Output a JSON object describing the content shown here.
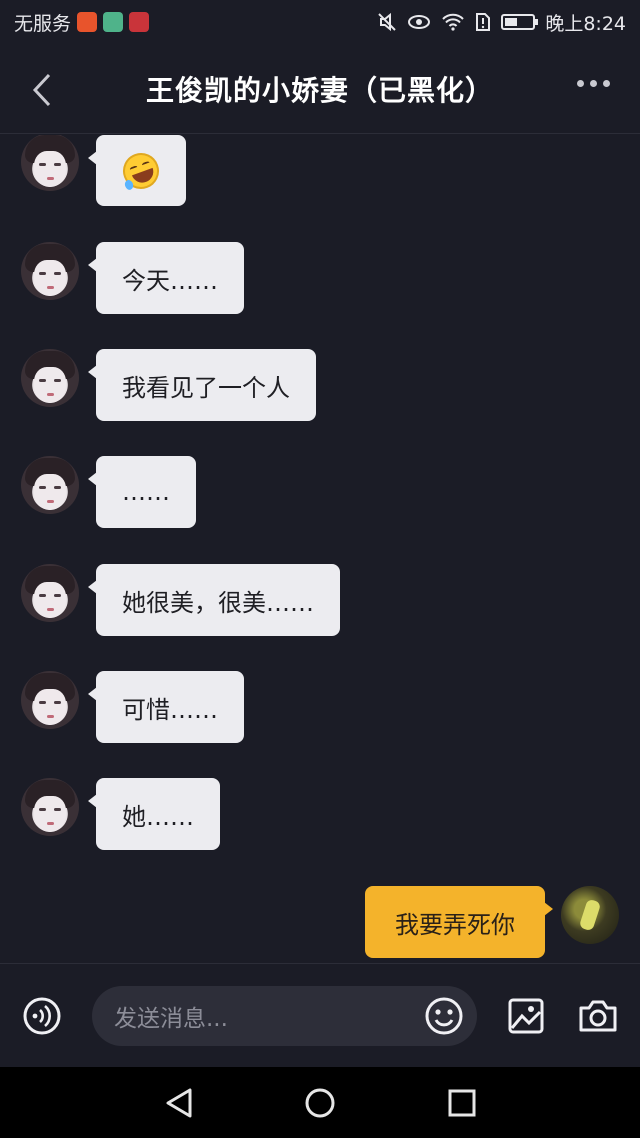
{
  "status_bar": {
    "carrier": "无服务",
    "time": "晚上8:24",
    "battery_level": 0.45
  },
  "header": {
    "title": "王俊凯的小娇妻（已黑化）"
  },
  "messages": [
    {
      "side": "left",
      "type": "emoji",
      "emoji": "rolling-on-floor-laughing-emoji",
      "text": ""
    },
    {
      "side": "left",
      "type": "text",
      "text": "今天……"
    },
    {
      "side": "left",
      "type": "text",
      "text": "我看见了一个人"
    },
    {
      "side": "left",
      "type": "text",
      "text": "……"
    },
    {
      "side": "left",
      "type": "text",
      "text": "她很美，很美……"
    },
    {
      "side": "left",
      "type": "text",
      "text": "可惜……"
    },
    {
      "side": "left",
      "type": "text",
      "text": "她……"
    },
    {
      "side": "right",
      "type": "text",
      "text": "我要弄死你"
    }
  ],
  "input_bar": {
    "placeholder": "发送消息..."
  },
  "colors": {
    "background": "#1b1c26",
    "incoming_bubble": "#ececf0",
    "outgoing_bubble": "#f4b32b"
  }
}
